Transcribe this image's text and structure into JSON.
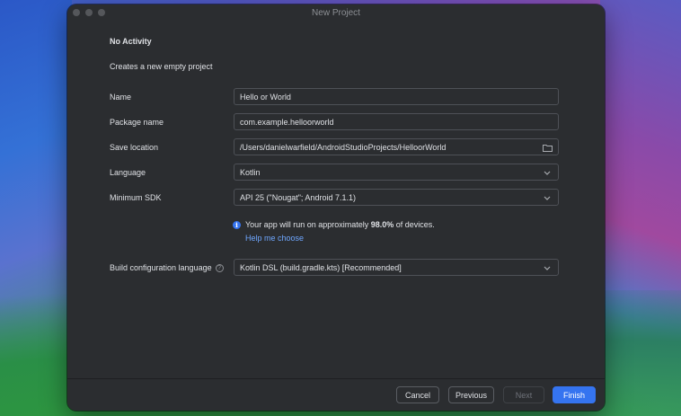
{
  "window": {
    "title": "New Project"
  },
  "header": {
    "heading": "No Activity",
    "subtitle": "Creates a new empty project"
  },
  "form": {
    "name": {
      "label": "Name",
      "value": "Hello or World"
    },
    "package": {
      "label": "Package name",
      "value": "com.example.helloorworld"
    },
    "save_location": {
      "label": "Save location",
      "value": "/Users/danielwarfield/AndroidStudioProjects/HelloorWorld",
      "icon": "folder-icon"
    },
    "language": {
      "label": "Language",
      "value": "Kotlin"
    },
    "min_sdk": {
      "label": "Minimum SDK",
      "value": "API 25 (\"Nougat\"; Android 7.1.1)"
    },
    "info": {
      "prefix": "Your app will run on approximately ",
      "percent": "98.0%",
      "suffix": " of devices.",
      "help_link": "Help me choose"
    },
    "build_config": {
      "label": "Build configuration language",
      "value": "Kotlin DSL (build.gradle.kts) [Recommended]"
    }
  },
  "footer": {
    "cancel": "Cancel",
    "previous": "Previous",
    "next": "Next",
    "finish": "Finish"
  },
  "colors": {
    "window_bg": "#2b2d30",
    "accent": "#3574f0",
    "link": "#6fa7ff",
    "text": "#dfe1e5"
  }
}
